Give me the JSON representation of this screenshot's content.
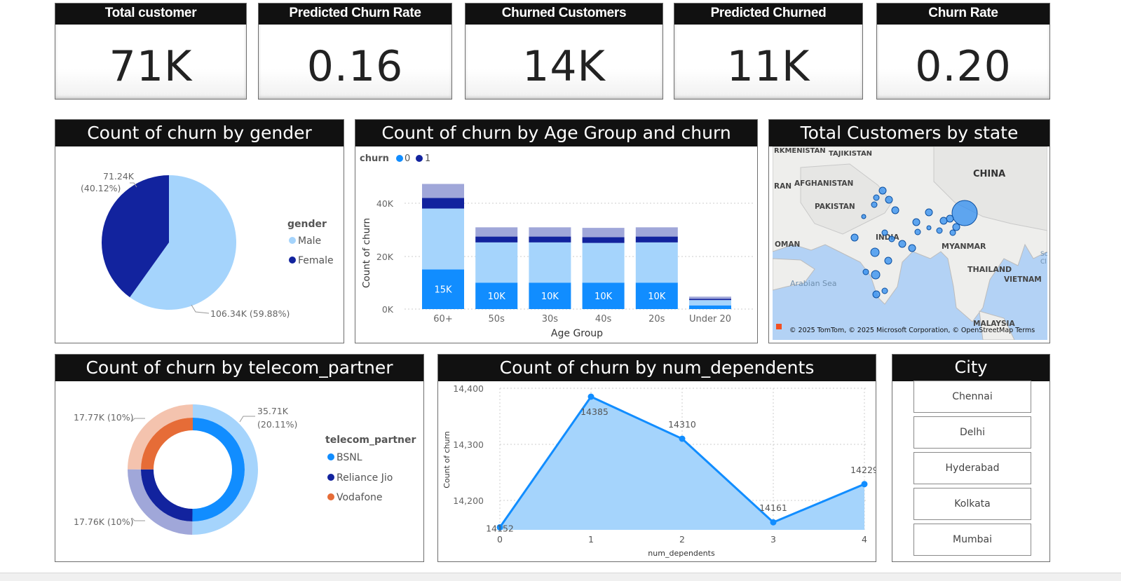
{
  "kpis": [
    {
      "title": "Total customer",
      "value": "71K"
    },
    {
      "title": "Predicted Churn Rate",
      "value": "0.16"
    },
    {
      "title": "Churned Customers",
      "value": "14K"
    },
    {
      "title": "Predicted Churned",
      "value": "11K"
    },
    {
      "title": "Churn Rate",
      "value": "0.20"
    }
  ],
  "gender_panel": {
    "title": "Count of churn by gender",
    "legend_title": "gender",
    "legend": [
      {
        "label": "Male",
        "color": "#a5d4fc"
      },
      {
        "label": "Female",
        "color": "#12239e"
      }
    ],
    "label_female_value": "71.24K",
    "label_female_pct": "(40.12%)",
    "label_male": "106.34K (59.88%)"
  },
  "age_panel": {
    "title": "Count of churn by Age Group and churn",
    "legend_title": "churn",
    "legend": [
      {
        "label": "0",
        "color": "#118dff"
      },
      {
        "label": "1",
        "color": "#12239e"
      }
    ],
    "xlabel": "Age Group",
    "ylabel": "Count of churn",
    "yticks": [
      "0K",
      "20K",
      "40K"
    ]
  },
  "map_panel": {
    "title": "Total Customers by state",
    "labels": [
      "RKMENISTAN",
      "TAJIKISTAN",
      "CHINA",
      "RAN",
      "AFGHANISTAN",
      "PAKISTAN",
      "INDIA",
      "OMAN",
      "MYANMAR",
      "THAILAND",
      "VIETNAM",
      "Arabian Sea",
      "MALAYSIA",
      "Sc",
      "Cl"
    ],
    "attribution": "© 2025 TomTom, © 2025 Microsoft Corporation, © OpenStreetMap  Terms"
  },
  "telecom_panel": {
    "title": "Count of churn by telecom_partner",
    "legend_title": "telecom_partner",
    "legend": [
      {
        "label": "BSNL",
        "color": "#118dff"
      },
      {
        "label": "Reliance Jio",
        "color": "#12239e"
      },
      {
        "label": "Vodafone",
        "color": "#e66c37"
      }
    ],
    "label_top_right_value": "35.71K",
    "label_top_right_pct": "(20.11%)",
    "label_top_left": "17.77K (10%)",
    "label_bottom_left": "17.76K (10%)"
  },
  "dependents_panel": {
    "title": "Count of churn by num_dependents",
    "xlabel": "num_dependents",
    "ylabel": "Count of churn",
    "yticks": [
      "14,200",
      "14,300",
      "14,400"
    ]
  },
  "city_panel": {
    "title": "City",
    "items": [
      "Chennai",
      "Delhi",
      "Hyderabad",
      "Kolkata",
      "Mumbai"
    ]
  },
  "chart_data": [
    {
      "type": "pie",
      "title": "Count of churn by gender",
      "categories": [
        "Male",
        "Female"
      ],
      "values": [
        106340,
        71240
      ],
      "percent": [
        59.88,
        40.12
      ]
    },
    {
      "type": "bar",
      "title": "Count of churn by Age Group and churn",
      "xlabel": "Age Group",
      "ylabel": "Count of churn",
      "categories": [
        "60+",
        "50s",
        "30s",
        "40s",
        "20s",
        "Under 20"
      ],
      "ylim": [
        0,
        48000
      ],
      "series": [
        {
          "name": "0",
          "values": [
            15000,
            10000,
            10000,
            10000,
            10000,
            1400
          ],
          "labels": [
            "15K",
            "10K",
            "10K",
            "10K",
            "10K",
            ""
          ]
        },
        {
          "name": "0",
          "values": [
            23000,
            15200,
            15200,
            15000,
            15200,
            2000
          ]
        },
        {
          "name": "1",
          "values": [
            4000,
            2200,
            2200,
            2200,
            2200,
            500
          ]
        },
        {
          "name": "1",
          "values": [
            5300,
            3500,
            3500,
            3500,
            3500,
            800
          ]
        }
      ]
    },
    {
      "type": "pie",
      "title": "Count of churn by telecom_partner",
      "categories": [
        "BSNL",
        "Reliance Jio",
        "Vodafone"
      ],
      "values": [
        35710,
        17760,
        17770
      ],
      "percent": [
        20.11,
        10,
        10
      ]
    },
    {
      "type": "area",
      "title": "Count of churn by num_dependents",
      "xlabel": "num_dependents",
      "ylabel": "Count of churn",
      "x": [
        0,
        1,
        2,
        3,
        4
      ],
      "y": [
        14152,
        14385,
        14310,
        14161,
        14229
      ],
      "ylim": [
        14140,
        14400
      ]
    }
  ]
}
